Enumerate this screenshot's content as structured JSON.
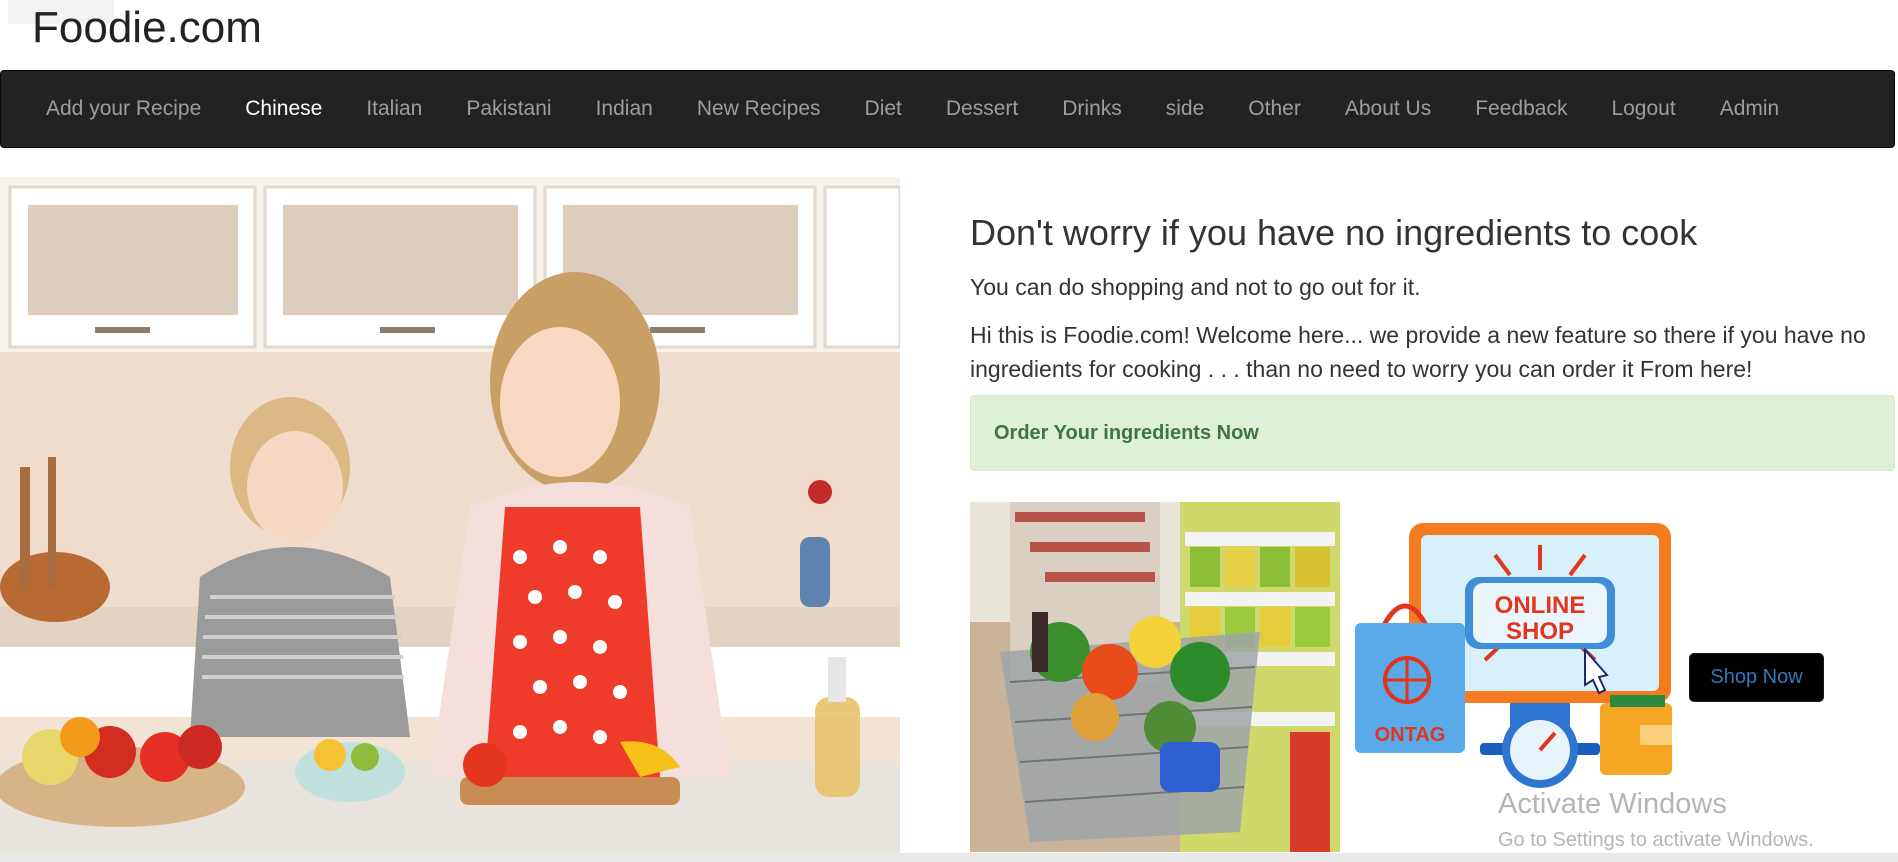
{
  "brand": {
    "title": "Foodie.com"
  },
  "nav": {
    "items": [
      {
        "label": "Add your Recipe",
        "active": false
      },
      {
        "label": "Chinese",
        "active": true
      },
      {
        "label": "Italian",
        "active": false
      },
      {
        "label": "Pakistani",
        "active": false
      },
      {
        "label": "Indian",
        "active": false
      },
      {
        "label": "New Recipes",
        "active": false
      },
      {
        "label": "Diet",
        "active": false
      },
      {
        "label": "Dessert",
        "active": false
      },
      {
        "label": "Drinks",
        "active": false
      },
      {
        "label": "side",
        "active": false
      },
      {
        "label": "Other",
        "active": false
      },
      {
        "label": "About Us",
        "active": false
      },
      {
        "label": "Feedback",
        "active": false
      },
      {
        "label": "Logout",
        "active": false
      },
      {
        "label": "Admin",
        "active": false
      }
    ]
  },
  "main": {
    "heading": "Don't worry if you have no ingredients to cook",
    "subheading": "You can do shopping and not to go out for it.",
    "paragraph": "Hi this is Foodie.com! Welcome here... we provide a new feature so there if you have no ingredients for cooking . . . than no need to worry you can order it From here!",
    "order_link": "Order Your ingredients Now",
    "shop_button": "Shop Now"
  },
  "shop_graphic": {
    "line1": "ONLINE",
    "line2": "SHOP",
    "bag_label": "ONTAG"
  },
  "watermark": {
    "title": "Activate Windows",
    "subtitle": "Go to Settings to activate Windows."
  },
  "colors": {
    "navbar_bg": "#222222",
    "nav_text": "#9d9d9d",
    "nav_active": "#ffffff",
    "alert_bg": "#dff0d8",
    "alert_text": "#3c763d",
    "button_text": "#337ab7"
  }
}
